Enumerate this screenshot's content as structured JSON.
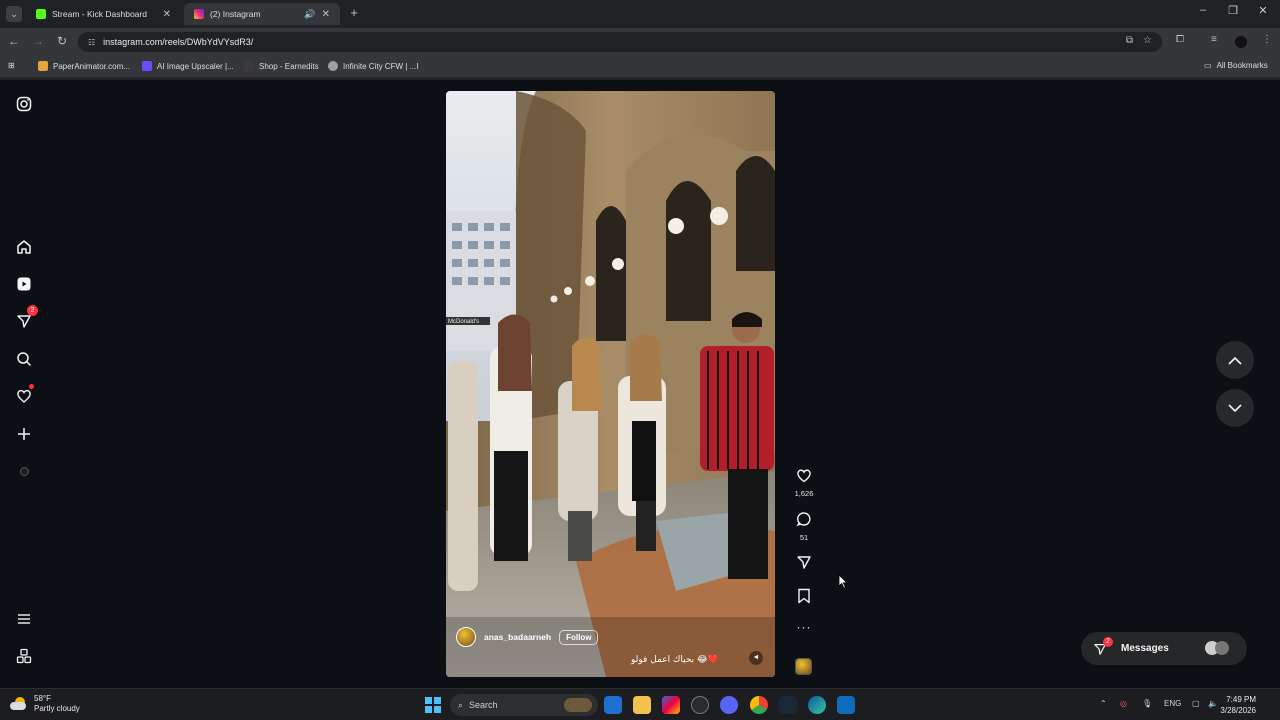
{
  "browser": {
    "tabs": [
      {
        "title": "Stream - Kick Dashboard",
        "favicon_color": "#53fc18",
        "active": false
      },
      {
        "title": "(2) Instagram",
        "favicon_color": "#e1306c",
        "active": true
      }
    ],
    "url": "instagram.com/reels/DWbYdVYsdR3/",
    "bookmarks": [
      {
        "label": "PaperAnimator.com...",
        "icon_color": "#e8a33d"
      },
      {
        "label": "AI Image Upscaler |...",
        "icon_color": "#6b4cff"
      },
      {
        "label": "Shop - Earnedits",
        "icon_color": "#3b3b3b"
      },
      {
        "label": "Infinite City CFW | ...I",
        "icon_color": "#9aa0a6"
      }
    ],
    "all_bookmarks_label": "All Bookmarks"
  },
  "sidebar": {
    "items": [
      {
        "name": "instagram-icon"
      },
      {
        "name": "home-icon"
      },
      {
        "name": "reels-icon"
      },
      {
        "name": "direct-icon",
        "badge": "2"
      },
      {
        "name": "search-icon"
      },
      {
        "name": "notifications-icon"
      },
      {
        "name": "create-icon"
      },
      {
        "name": "profile-icon"
      },
      {
        "name": "menu-icon"
      },
      {
        "name": "more-icon"
      }
    ]
  },
  "reel": {
    "username": "anas_badaarneh",
    "follow_label": "Follow",
    "caption": "بحياك اعمل فولو 😂❤️",
    "likes": "1,626",
    "comments": "51"
  },
  "messages": {
    "label": "Messages",
    "badge": "2"
  },
  "taskbar": {
    "weather_temp": "58°F",
    "weather_desc": "Partly cloudy",
    "search_label": "Search",
    "language": "ENG",
    "time": "7:49 PM",
    "date": "3/28/2026"
  },
  "colors": {
    "instagram_red": "#ff3040",
    "background": "#0c0f13",
    "windows_accent": "#4cc2ff"
  }
}
